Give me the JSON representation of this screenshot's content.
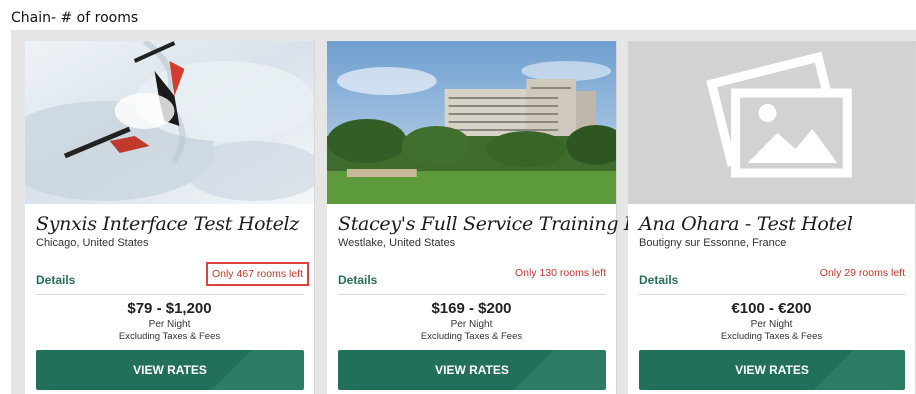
{
  "caption": "Chain- # of rooms",
  "hotels": [
    {
      "name": "Synxis Interface Test Hotelz",
      "location": "Chicago, United States",
      "details_label": "Details",
      "rooms_left": "Only 467 rooms left",
      "price": "$79 - $1,200",
      "per_night": "Per Night",
      "taxes": "Excluding Taxes & Fees",
      "cta": "VIEW RATES",
      "image": "skier-photo"
    },
    {
      "name": "Stacey's Full Service Training Hotel",
      "location": "Westlake, United States",
      "details_label": "Details",
      "rooms_left": "Only 130 rooms left",
      "price": "$169 - $200",
      "per_night": "Per Night",
      "taxes": "Excluding Taxes & Fees",
      "cta": "VIEW RATES",
      "image": "hotel-building-photo"
    },
    {
      "name": "Ana Ohara - Test Hotel",
      "location": "Boutigny sur Essonne, France",
      "details_label": "Details",
      "rooms_left": "Only 29 rooms left",
      "price": "€100 - €200",
      "per_night": "Per Night",
      "taxes": "Excluding Taxes & Fees",
      "cta": "VIEW RATES",
      "image": "image-placeholder-icon"
    }
  ],
  "colors": {
    "accent_green": "#22705b",
    "rooms_left_red": "#c0392b",
    "highlight_red": "#e0413e"
  }
}
